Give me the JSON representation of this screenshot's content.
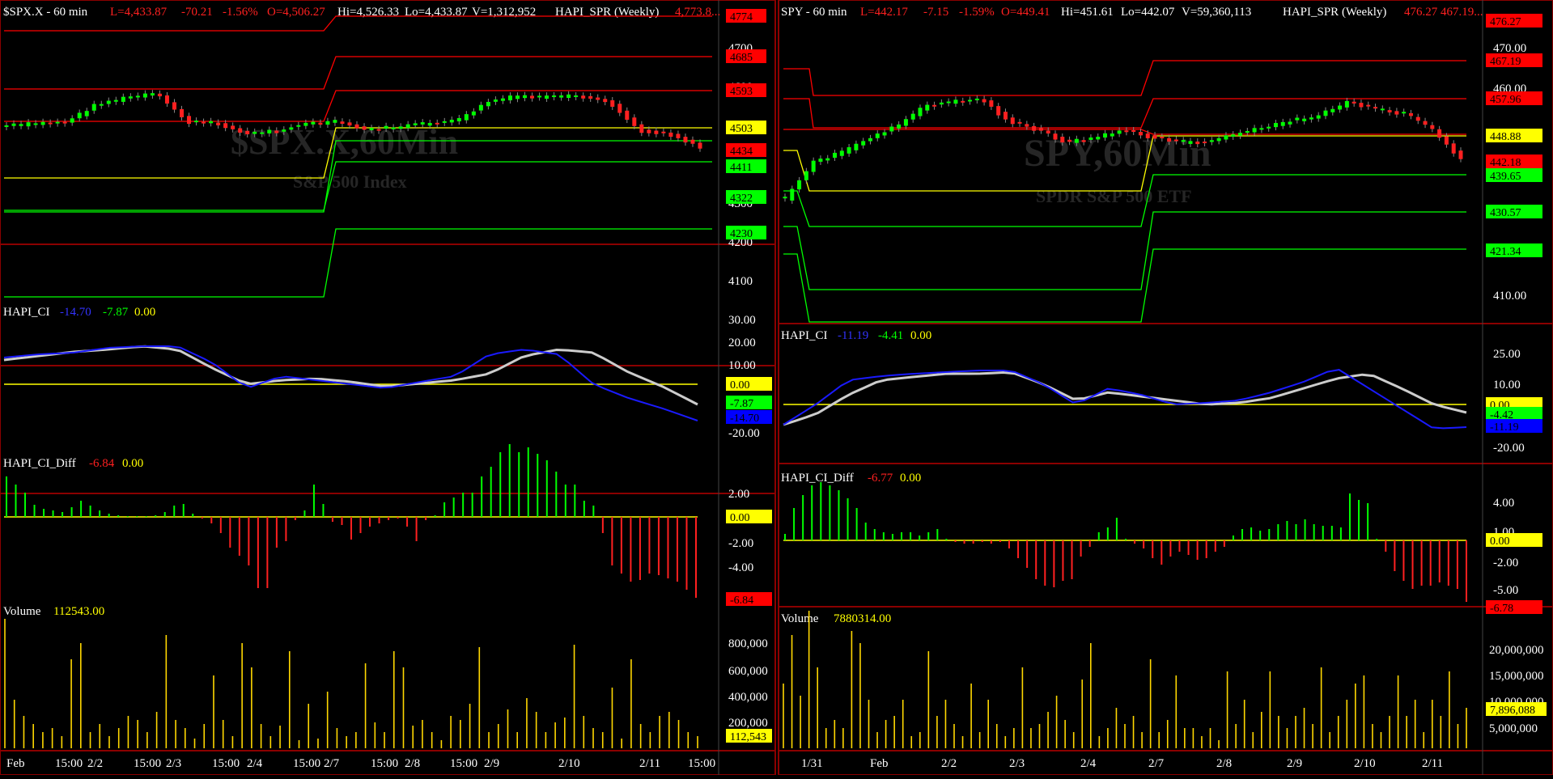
{
  "left_chart": {
    "symbol_line": "$SPX.X - 60 min",
    "last": "L=4,433.87",
    "change": "-70.21",
    "change_pct": "-1.56%",
    "open": "O=4,506.27",
    "high": "Hi=4,526.33",
    "low": "Lo=4,433.87",
    "volume": "V=1,312,952",
    "indicator_name": "HAPI_SPR (Weekly)",
    "indicator_values": "4,773.8...",
    "watermark_symbol": "$SPX.X,60Min",
    "watermark_name": "S&P 500 Index",
    "price_axis": {
      "ticks": [
        "4700",
        "4600",
        "4500",
        "4400",
        "4300",
        "4200",
        "4100"
      ],
      "tags": [
        {
          "label": "4774",
          "color": "#ff0000"
        },
        {
          "label": "4685",
          "color": "#ff0000"
        },
        {
          "label": "4593",
          "color": "#ff0000"
        },
        {
          "label": "4503",
          "color": "#ffff00"
        },
        {
          "label": "4434",
          "color": "#ff0000"
        },
        {
          "label": "4411",
          "color": "#00ff00"
        },
        {
          "label": "4322",
          "color": "#00ff00"
        },
        {
          "label": "4230",
          "color": "#00ff00"
        }
      ]
    },
    "ci_panel": {
      "name": "HAPI_CI",
      "v1": "-14.70",
      "v2": "-7.87",
      "v3": "0.00",
      "ticks": [
        "30.00",
        "20.00",
        "10.00",
        "0.00",
        "-10.00",
        "-20.00"
      ],
      "tags": [
        {
          "label": "0.00",
          "color": "#ffff00"
        },
        {
          "label": "-7.87",
          "color": "#00ff00"
        },
        {
          "label": "-14.70",
          "color": "#0000ff"
        }
      ]
    },
    "diff_panel": {
      "name": "HAPI_CI_Diff",
      "v1": "-6.84",
      "v2": "0.00",
      "ticks": [
        "2.00",
        "0.00",
        "-2.00",
        "-4.00"
      ],
      "tags": [
        {
          "label": "0.00",
          "color": "#ffff00"
        },
        {
          "label": "-6.84",
          "color": "#ff0000"
        }
      ]
    },
    "volume_panel": {
      "name": "Volume",
      "v1": "112543.00",
      "ticks": [
        "800,000",
        "600,000",
        "400,000",
        "200,000"
      ],
      "tags": [
        {
          "label": "112,543",
          "color": "#ffff00"
        }
      ]
    },
    "x_axis": [
      "Feb",
      "15:00",
      "2/2",
      "15:00",
      "2/3",
      "15:00",
      "2/4",
      "15:00",
      "2/7",
      "15:00",
      "2/8",
      "15:00",
      "2/9",
      "2/10",
      "2/11",
      "15:00"
    ]
  },
  "right_chart": {
    "symbol_line": "SPY - 60 min",
    "last": "L=442.17",
    "change": "-7.15",
    "change_pct": "-1.59%",
    "open": "O=449.41",
    "high": "Hi=451.61",
    "low": "Lo=442.07",
    "volume": "V=59,360,113",
    "indicator_name": "HAPI_SPR (Weekly)",
    "indicator_values": "476.27  467.19...",
    "watermark_symbol": "SPY,60Min",
    "watermark_name": "SPDR S&P 500 ETF",
    "price_axis": {
      "ticks": [
        "470.00",
        "460.00",
        "450.00",
        "440.00",
        "420.00",
        "410.00"
      ],
      "tags": [
        {
          "label": "476.27",
          "color": "#ff0000"
        },
        {
          "label": "467.19",
          "color": "#ff0000"
        },
        {
          "label": "457.96",
          "color": "#ff0000"
        },
        {
          "label": "448.88",
          "color": "#ffff00"
        },
        {
          "label": "442.18",
          "color": "#ff0000"
        },
        {
          "label": "439.65",
          "color": "#00ff00"
        },
        {
          "label": "430.57",
          "color": "#00ff00"
        },
        {
          "label": "421.34",
          "color": "#00ff00"
        }
      ]
    },
    "ci_panel": {
      "name": "HAPI_CI",
      "v1": "-11.19",
      "v2": "-4.41",
      "v3": "0.00",
      "ticks": [
        "25.00",
        "10.00",
        "-20.00"
      ],
      "tags": [
        {
          "label": "0.00",
          "color": "#ffff00"
        },
        {
          "label": "-4.42",
          "color": "#00ff00"
        },
        {
          "label": "-11.19",
          "color": "#0000ff"
        }
      ]
    },
    "diff_panel": {
      "name": "HAPI_CI_Diff",
      "v1": "-6.77",
      "v2": "0.00",
      "ticks": [
        "4.00",
        "1.00",
        "-2.00",
        "-5.00"
      ],
      "tags": [
        {
          "label": "0.00",
          "color": "#ffff00"
        },
        {
          "label": "-6.78",
          "color": "#ff0000"
        }
      ]
    },
    "volume_panel": {
      "name": "Volume",
      "v1": "7880314.00",
      "ticks": [
        "20,000,000",
        "15,000,000",
        "10,000,000",
        "5,000,000"
      ],
      "tags": [
        {
          "label": "7,896,088",
          "color": "#ffff00"
        }
      ]
    },
    "x_axis": [
      "1/31",
      "Feb",
      "2/2",
      "2/3",
      "2/4",
      "2/7",
      "2/8",
      "2/9",
      "2/10",
      "2/11"
    ]
  },
  "colors": {
    "background": "#000000",
    "up_candle": "#00ff00",
    "down_candle": "#ff2020",
    "ci_blue": "#1a1aff",
    "ci_red": "#ff0000",
    "ci_gray": "#cccccc",
    "level_yellow": "#ffff00",
    "volume": "#ffd700",
    "panel_border": "#8b0000"
  }
}
